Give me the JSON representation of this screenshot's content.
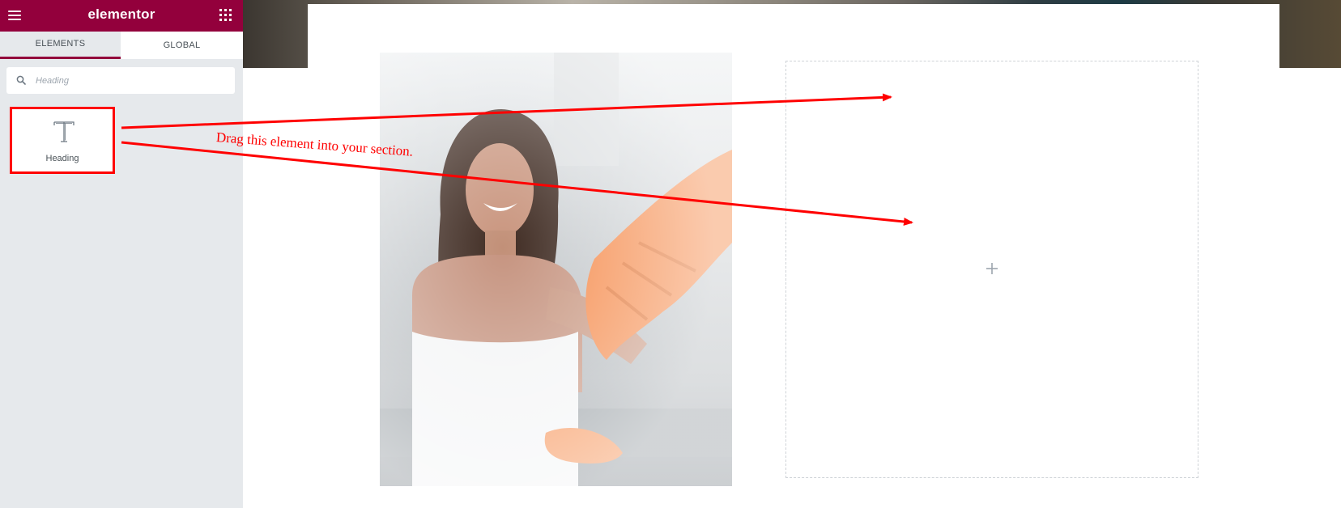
{
  "sidebar": {
    "logo": "elementor",
    "tabs": [
      {
        "label": "ELEMENTS",
        "active": true
      },
      {
        "label": "GLOBAL",
        "active": false
      }
    ],
    "search": {
      "placeholder": "Heading",
      "value": ""
    },
    "widgets": [
      {
        "label": "Heading",
        "icon": "heading-t-icon"
      }
    ]
  },
  "canvas": {
    "drop_area_action": "add-element"
  },
  "annotation": {
    "text": "Drag this element into your section.",
    "color": "#ff0000"
  },
  "colors": {
    "brand": "#93003c",
    "panel": "#e6e9ec",
    "annotation": "#ff0000"
  }
}
